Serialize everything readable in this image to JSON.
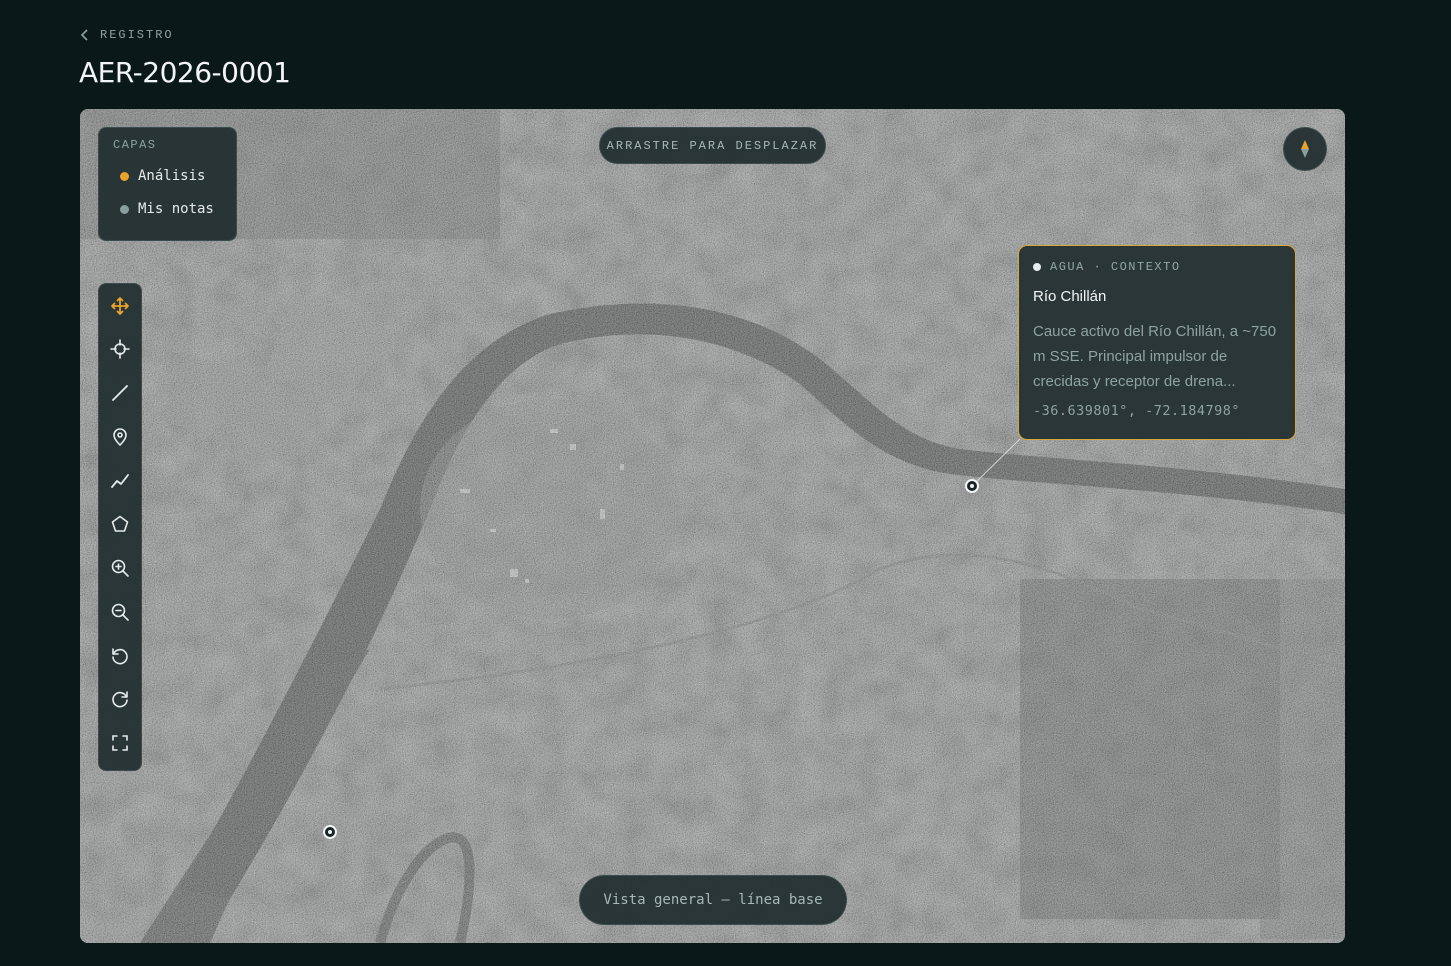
{
  "header": {
    "back_label": "REGISTRO",
    "title": "AER-2026-0001"
  },
  "layers": {
    "title": "CAPAS",
    "items": [
      {
        "label": "Análisis",
        "color": "#e8a22e"
      },
      {
        "label": "Mis notas",
        "color": "#8a9ea0"
      }
    ]
  },
  "drag_hint": "ARRASTRE PARA DESPLAZAR",
  "compass": {
    "icon": "compass-north-icon"
  },
  "toolbar": {
    "tools": [
      {
        "name": "pan",
        "icon": "move-icon",
        "active": true
      },
      {
        "name": "crosshair",
        "icon": "crosshair-icon"
      },
      {
        "name": "measure-line",
        "icon": "line-icon"
      },
      {
        "name": "place-pin",
        "icon": "pin-icon"
      },
      {
        "name": "polyline",
        "icon": "polyline-icon"
      },
      {
        "name": "polygon",
        "icon": "polygon-icon"
      },
      {
        "name": "zoom-in",
        "icon": "zoom-in-icon"
      },
      {
        "name": "zoom-out",
        "icon": "zoom-out-icon"
      },
      {
        "name": "rotate-left",
        "icon": "rotate-left-icon"
      },
      {
        "name": "rotate-right",
        "icon": "rotate-right-icon"
      },
      {
        "name": "fullscreen",
        "icon": "fullscreen-icon"
      }
    ]
  },
  "popup": {
    "tag": "AGUA · CONTEXTO",
    "title": "Río Chillán",
    "description": "Cauce activo del Río Chillán, a ~750 m SSE. Principal impulsor de crecidas y receptor de drena...",
    "coords": "-36.639801°, -72.184798°"
  },
  "view_label": "Vista general — línea base",
  "colors": {
    "accent": "#e8a22e",
    "popup_border": "#d9a83a",
    "background": "#0a1818"
  }
}
